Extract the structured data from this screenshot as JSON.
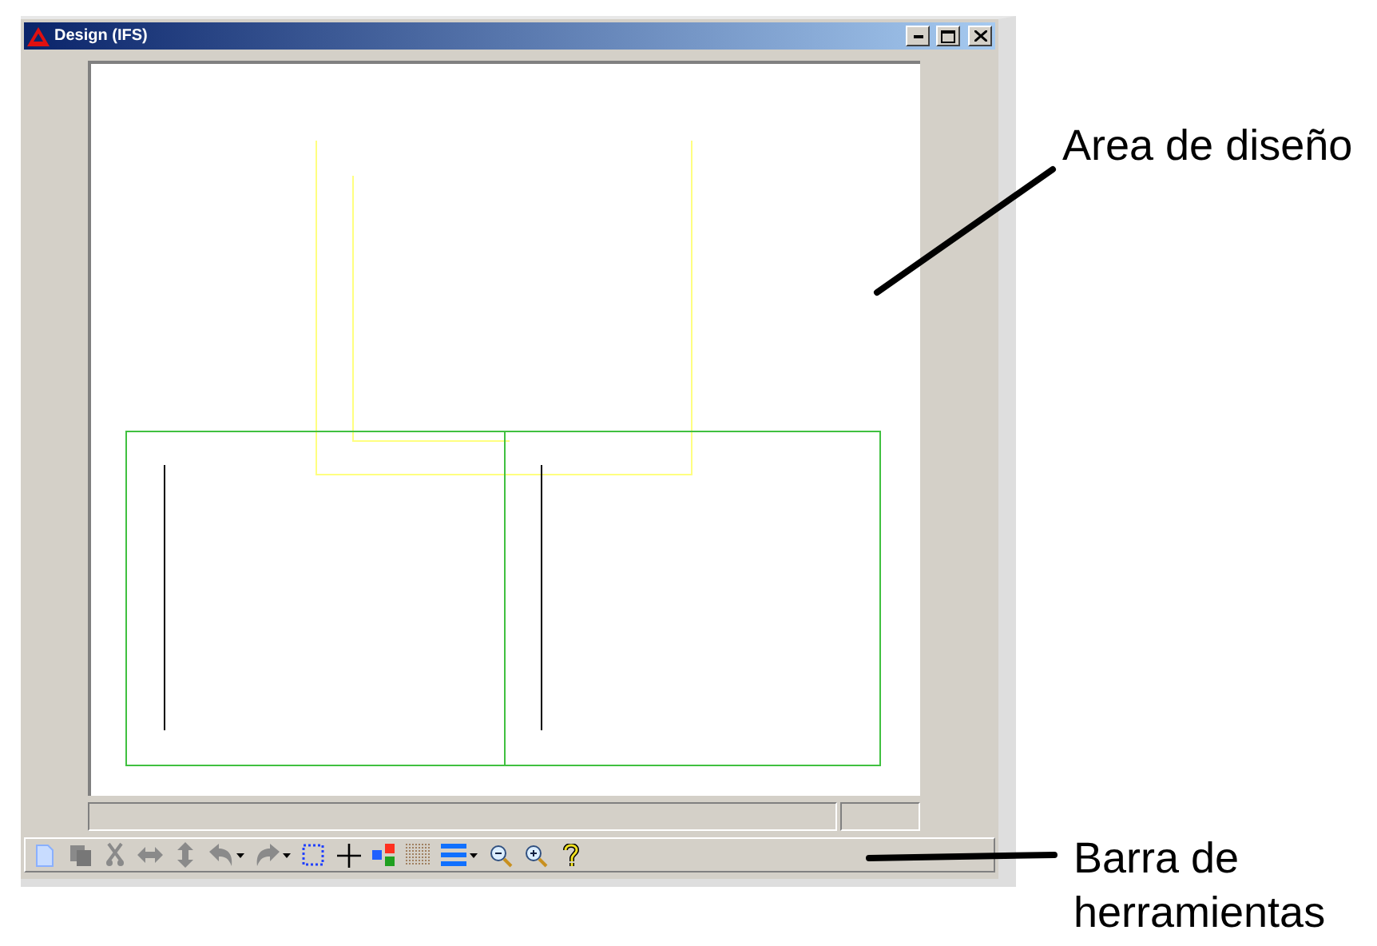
{
  "window": {
    "title": "Design (IFS)"
  },
  "design_area": {
    "shapes": [
      {
        "kind": "open-rect",
        "color": "#ffff80"
      },
      {
        "kind": "corner",
        "color": "#ffff80"
      },
      {
        "kind": "rect",
        "color": "#40c040"
      },
      {
        "kind": "rect",
        "color": "#40c040"
      },
      {
        "kind": "vline",
        "color": "#000000"
      },
      {
        "kind": "vline",
        "color": "#000000"
      }
    ]
  },
  "toolbar": [
    {
      "kind": "new",
      "disabled": false,
      "dropdown": false
    },
    {
      "kind": "copy",
      "disabled": true,
      "dropdown": false
    },
    {
      "kind": "cut",
      "disabled": true,
      "dropdown": false
    },
    {
      "kind": "flip-h",
      "disabled": true,
      "dropdown": false
    },
    {
      "kind": "flip-v",
      "disabled": true,
      "dropdown": false
    },
    {
      "kind": "undo",
      "disabled": true,
      "dropdown": true
    },
    {
      "kind": "redo",
      "disabled": true,
      "dropdown": true
    },
    {
      "kind": "select",
      "disabled": false,
      "dropdown": false
    },
    {
      "kind": "cross",
      "disabled": false,
      "dropdown": false
    },
    {
      "kind": "colors",
      "disabled": false,
      "dropdown": false
    },
    {
      "kind": "grid",
      "disabled": false,
      "dropdown": false
    },
    {
      "kind": "lines",
      "disabled": false,
      "dropdown": true
    },
    {
      "kind": "zoom-out",
      "disabled": false,
      "dropdown": false
    },
    {
      "kind": "zoom-in",
      "disabled": false,
      "dropdown": false
    },
    {
      "kind": "help",
      "disabled": false,
      "dropdown": false
    }
  ],
  "callouts": [
    {
      "text": "Area de diseño"
    },
    {
      "text": "Barra de herramientas"
    }
  ]
}
